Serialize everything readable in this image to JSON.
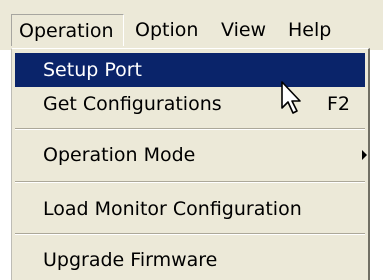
{
  "menubar": {
    "items": [
      "Operation",
      "Option",
      "View",
      "Help"
    ]
  },
  "menu": {
    "setup_port": "Setup Port",
    "get_configurations": "Get Configurations",
    "get_configurations_shortcut": "F2",
    "operation_mode": "Operation Mode",
    "load_monitor_configuration": "Load Monitor Configuration",
    "upgrade_firmware": "Upgrade Firmware"
  },
  "colors": {
    "highlight": "#0a246a",
    "menu_bg": "#ece9d8"
  },
  "icons": {
    "cursor": "mouse-pointer-icon",
    "submenu": "submenu-arrow-icon"
  }
}
